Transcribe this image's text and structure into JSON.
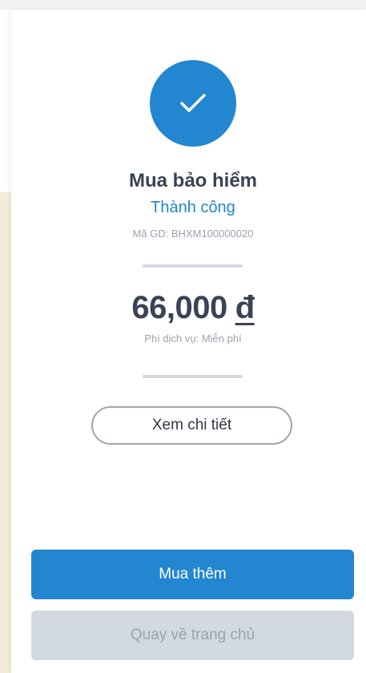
{
  "result": {
    "title": "Mua bảo hiểm",
    "status": "Thành công",
    "transaction_id": "Mã GD: BHXM100000020",
    "amount": "66,000",
    "currency": "đ",
    "fee": "Phí dịch vụ: Miễn phí",
    "success_icon": "checkmark-icon"
  },
  "actions": {
    "detail_label": "Xem chi tiết",
    "buy_more_label": "Mua thêm",
    "home_label": "Quay về trang chủ"
  },
  "colors": {
    "accent": "#2386d0",
    "text_dark": "#3a4254",
    "text_muted": "#9aa3ad",
    "divider": "#d3d9e0",
    "disabled_bg": "#d3d9e2",
    "side_background": "#f3ecd9"
  }
}
